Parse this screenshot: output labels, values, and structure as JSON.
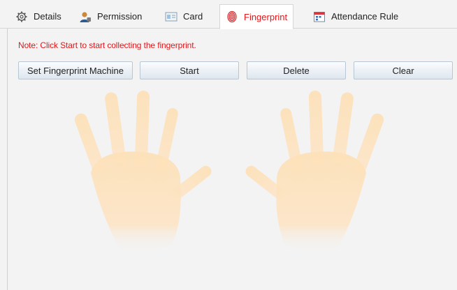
{
  "tabs": [
    {
      "label": "Details",
      "icon": "gear-icon"
    },
    {
      "label": "Permission",
      "icon": "user-icon"
    },
    {
      "label": "Card",
      "icon": "card-icon"
    },
    {
      "label": "Fingerprint",
      "icon": "fingerprint-icon",
      "active": true
    },
    {
      "label": "Attendance Rule",
      "icon": "calendar-icon"
    }
  ],
  "note": "Note: Click Start to start collecting the fingerprint.",
  "buttons": {
    "set_machine": "Set Fingerprint Machine",
    "start": "Start",
    "delete": "Delete",
    "clear": "Clear"
  },
  "colors": {
    "note_text": "#e0161a",
    "active_tab_text": "#e0161a",
    "hand_fill": "#fde1b8"
  }
}
